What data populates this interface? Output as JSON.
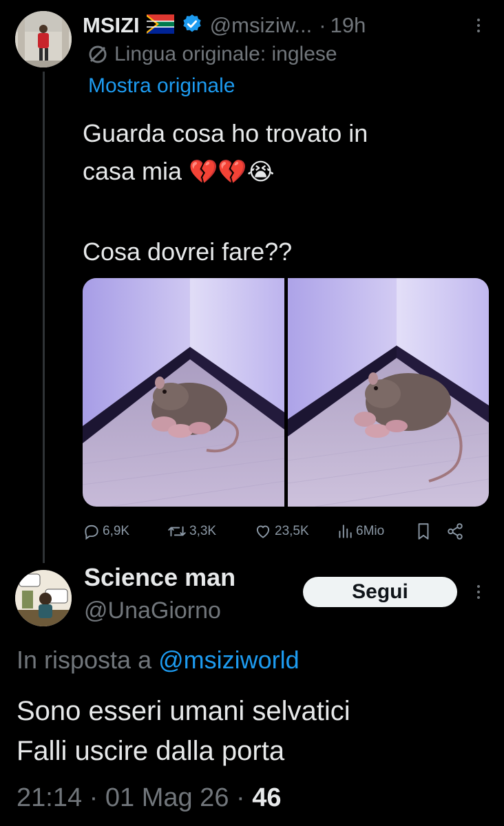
{
  "main_tweet": {
    "author_name": "MSIZI",
    "flag": "south-africa-flag",
    "verified": true,
    "handle": "@msiziw...",
    "separator": "·",
    "time": "19h",
    "translation_note": "Lingua originale: inglese",
    "show_original": "Mostra originale",
    "text_line1": "Guarda cosa ho trovato in",
    "text_line2": "casa mia",
    "text_emojis": "💔💔😭",
    "text_line3": "Cosa dovrei fare??",
    "images": [
      {
        "subject": "rat-with-babies-photo"
      },
      {
        "subject": "rat-with-babies-photo"
      }
    ],
    "stats": {
      "replies": "6,9K",
      "reposts": "3,3K",
      "likes": "23,5K",
      "views": "6Mio"
    }
  },
  "reply": {
    "author_name": "Science man",
    "handle": "@UnaGiorno",
    "follow_label": "Segui",
    "in_reply_prefix": "In risposta a",
    "in_reply_mention": "@msiziworld",
    "text_line1": "Sono esseri umani selvatici",
    "text_line2": "Falli uscire dalla porta",
    "time": "21:14",
    "separator1": "·",
    "date": "01 Mag 26",
    "separator2": "·",
    "views": "46"
  },
  "colors": {
    "background": "#000000",
    "text": "#e7e9ea",
    "muted": "#71767b",
    "accent": "#1d9bf0",
    "verified": "#1d9bf0"
  }
}
